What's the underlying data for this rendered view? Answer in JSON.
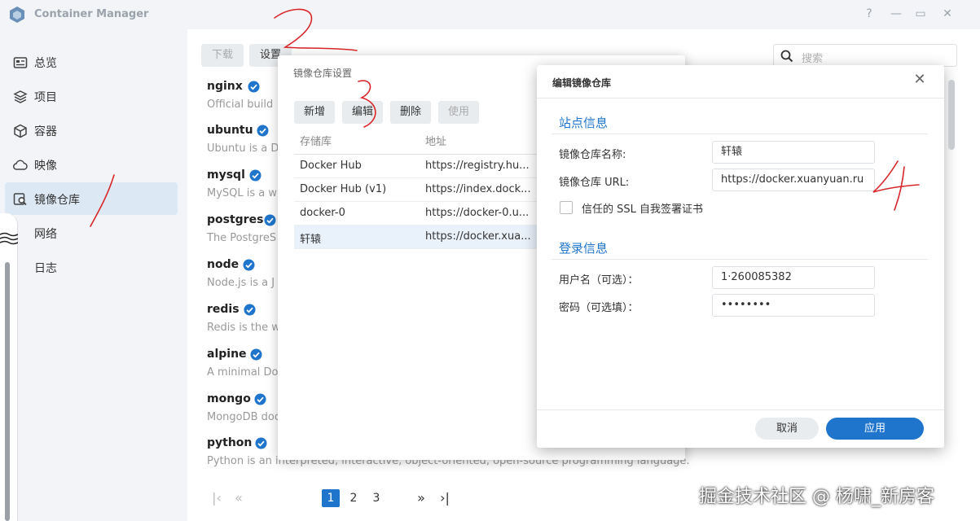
{
  "app": {
    "title": "Container Manager"
  },
  "window_controls": [
    "?",
    "—",
    "▭",
    "✕"
  ],
  "sidebar": {
    "items": [
      {
        "label": "总览",
        "icon": "overview-icon"
      },
      {
        "label": "项目",
        "icon": "project-icon"
      },
      {
        "label": "容器",
        "icon": "container-icon"
      },
      {
        "label": "映像",
        "icon": "image-icon"
      },
      {
        "label": "镜像仓库",
        "icon": "registry-icon",
        "active": true
      },
      {
        "label": "网络",
        "icon": "network-icon"
      },
      {
        "label": "日志",
        "icon": "log-icon"
      }
    ]
  },
  "toolbar": {
    "download": "下载",
    "settings": "设置"
  },
  "search": {
    "placeholder": "搜索"
  },
  "repos": [
    {
      "name": "nginx",
      "desc": "Official build"
    },
    {
      "name": "ubuntu",
      "desc": "Ubuntu is a D"
    },
    {
      "name": "mysql",
      "desc": "MySQL is a w"
    },
    {
      "name": "postgres",
      "desc": "The PostgreS"
    },
    {
      "name": "node",
      "desc": "Node.js is a J"
    },
    {
      "name": "redis",
      "desc": "Redis is the w"
    },
    {
      "name": "alpine",
      "desc": "A minimal Do"
    },
    {
      "name": "mongo",
      "desc": "MongoDB doc"
    },
    {
      "name": "python",
      "desc": "Python is an interpreted, interactive, object-oriented, open-source programming language."
    }
  ],
  "pagination": {
    "pages": [
      "1",
      "2",
      "3"
    ],
    "current": "1",
    "first": "|‹",
    "prev": "«",
    "next": "»",
    "last": "›|"
  },
  "registry_dialog": {
    "title": "镜像仓库设置",
    "buttons": {
      "add": "新增",
      "edit": "编辑",
      "delete": "删除",
      "use": "使用"
    },
    "columns": {
      "name": "存储库",
      "address": "地址"
    },
    "rows": [
      {
        "name": "Docker Hub",
        "address": "https://registry.hu..."
      },
      {
        "name": "Docker Hub (v1)",
        "address": "https://index.dock..."
      },
      {
        "name": "docker-0",
        "address": "https://docker-0.u..."
      },
      {
        "name": "轩辕",
        "address": "https://docker.xua...",
        "selected": true
      }
    ]
  },
  "edit_dialog": {
    "title": "编辑镜像仓库",
    "site_section": "站点信息",
    "name_label": "镜像仓库名称:",
    "name_value": "轩辕",
    "url_label": "镜像仓库 URL:",
    "url_value": "https://docker.xuanyuan.ru",
    "ssl_label": "信任的 SSL 自我签署证书",
    "ssl_checked": false,
    "login_section": "登录信息",
    "username_label": "用户名（可选）：",
    "username_value": "1·260085382",
    "password_label": "密码（可选填）：",
    "password_value": "••••••••",
    "cancel": "取消",
    "apply": "应用"
  },
  "watermark": "掘金技术社区 @ 杨啸_新房客",
  "colors": {
    "accent": "#1f75cb",
    "annotation": "#d8262a",
    "sidebar_bg": "#f2f4f7"
  }
}
